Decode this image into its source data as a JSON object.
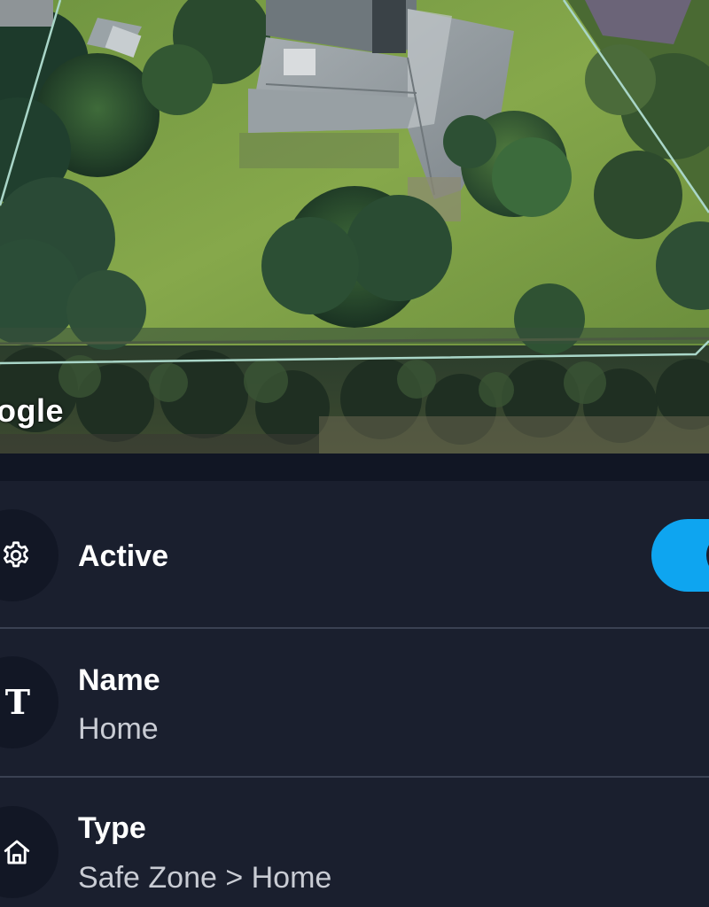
{
  "map": {
    "attribution": "ogle",
    "zone_outline_color": "#a9d6c8"
  },
  "settings": {
    "active": {
      "icon": "gear-icon",
      "label": "Active",
      "enabled": true,
      "toggle_color": "#0ea5f0"
    },
    "name": {
      "icon": "text-icon",
      "label": "Name",
      "value": "Home"
    },
    "type": {
      "icon": "home-icon",
      "label": "Type",
      "value": "Safe Zone > Home"
    }
  }
}
